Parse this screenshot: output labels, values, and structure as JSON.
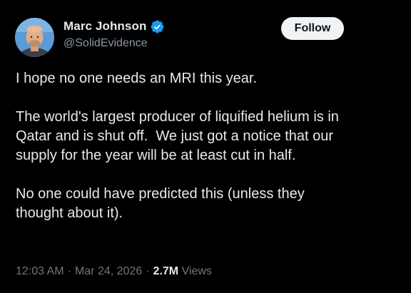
{
  "author": {
    "display_name": "Marc Johnson",
    "handle": "@SolidEvidence",
    "verified": true,
    "verified_color": "#1d9bf0"
  },
  "follow_label": "Follow",
  "tweet": {
    "paragraphs": [
      "I hope no one needs an MRI this year.",
      "The world's largest producer of liquified helium is in\nQatar and is shut off.  We just got a notice that our\nsupply for the year will be at least cut in half.",
      "No one could have predicted this (unless they\nthought about it)."
    ]
  },
  "meta": {
    "time": "12:03 AM",
    "separator": "·",
    "date": "Mar 24, 2026",
    "views_count": "2.7M",
    "views_label": "Views"
  },
  "colors": {
    "background": "#000000",
    "text": "#e7e9ea",
    "secondary": "#71767b",
    "button_bg": "#eff3f4"
  }
}
